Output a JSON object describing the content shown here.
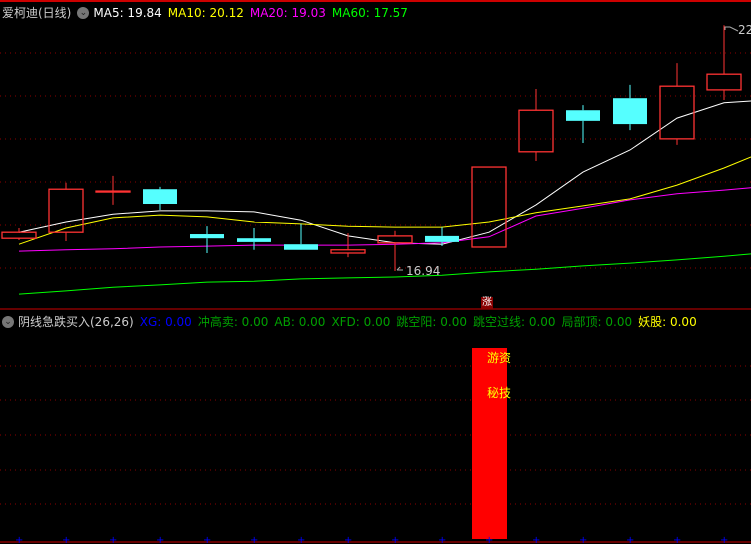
{
  "header": {
    "stock_name": "爱柯迪(日线)",
    "ma": [
      {
        "label": "MA5: 19.84",
        "color": "#ffffff"
      },
      {
        "label": "MA10: 20.12",
        "color": "#ffff00"
      },
      {
        "label": "MA20: 19.03",
        "color": "#ff00ff"
      },
      {
        "label": "MA60: 17.57",
        "color": "#00ff00"
      }
    ]
  },
  "indicator_header": {
    "name": "阴线急跌买入(26,26)",
    "items": [
      {
        "label": "XG: 0.00",
        "color": "#0000ff"
      },
      {
        "label": "冲高卖: 0.00",
        "color": "#00a000"
      },
      {
        "label": "AB: 0.00",
        "color": "#00a000"
      },
      {
        "label": "XFD: 0.00",
        "color": "#00a000"
      },
      {
        "label": "跳空阳: 0.00",
        "color": "#00a000"
      },
      {
        "label": "跳空过线: 0.00",
        "color": "#00a000"
      },
      {
        "label": "局部顶: 0.00",
        "color": "#00a000"
      },
      {
        "label": "妖股: 0.00",
        "color": "#ffff00"
      }
    ]
  },
  "annotations": {
    "high_label": "22",
    "low_label": "16.94",
    "up_marker": "涨",
    "signal_text_1": "游资",
    "signal_text_2": "秘技"
  },
  "colors": {
    "up": "#ff3333",
    "down": "#55ffff",
    "grid": "#8b0000",
    "border": "#cc0000"
  },
  "chart_data": [
    {
      "type": "candlestick",
      "candles": [
        {
          "o": 17.65,
          "h": 17.87,
          "l": 17.61,
          "c": 17.78
        },
        {
          "o": 17.78,
          "h": 18.85,
          "l": 17.59,
          "c": 18.71
        },
        {
          "o": 18.67,
          "h": 19.0,
          "l": 18.37,
          "c": 18.67
        },
        {
          "o": 18.71,
          "h": 18.76,
          "l": 18.26,
          "c": 18.39
        },
        {
          "o": 17.74,
          "h": 17.91,
          "l": 17.33,
          "c": 17.65
        },
        {
          "o": 17.65,
          "h": 17.87,
          "l": 17.4,
          "c": 17.57
        },
        {
          "o": 17.52,
          "h": 17.96,
          "l": 17.4,
          "c": 17.4
        },
        {
          "o": 17.33,
          "h": 17.76,
          "l": 17.24,
          "c": 17.4
        },
        {
          "o": 17.55,
          "h": 17.81,
          "l": 16.94,
          "c": 17.7
        },
        {
          "o": 17.7,
          "h": 17.89,
          "l": 17.48,
          "c": 17.57
        },
        {
          "o": 17.46,
          "h": 19.19,
          "l": 17.46,
          "c": 19.19
        },
        {
          "o": 19.52,
          "h": 20.88,
          "l": 19.32,
          "c": 20.42
        },
        {
          "o": 20.42,
          "h": 20.53,
          "l": 19.71,
          "c": 20.19
        },
        {
          "o": 20.68,
          "h": 20.97,
          "l": 19.99,
          "c": 20.12
        },
        {
          "o": 19.8,
          "h": 21.44,
          "l": 19.67,
          "c": 20.94
        },
        {
          "o": 20.86,
          "h": 22.26,
          "l": 20.64,
          "c": 21.2
        }
      ],
      "series": [
        {
          "name": "MA5",
          "color": "#ffffff",
          "values": [
            17.78,
            18.0,
            18.17,
            18.24,
            18.24,
            18.22,
            18.04,
            17.7,
            17.55,
            17.52,
            17.78,
            18.37,
            19.08,
            19.56,
            20.25,
            20.58,
            20.62
          ]
        },
        {
          "name": "MA10",
          "color": "#ffff00",
          "values": [
            17.52,
            17.87,
            18.09,
            18.15,
            18.11,
            18.0,
            17.96,
            17.91,
            17.89,
            17.89,
            18.0,
            18.2,
            18.35,
            18.5,
            18.8,
            19.17,
            19.41
          ]
        },
        {
          "name": "MA20",
          "color": "#ff00ff",
          "values": [
            17.37,
            17.4,
            17.42,
            17.46,
            17.48,
            17.5,
            17.5,
            17.5,
            17.52,
            17.55,
            17.68,
            18.13,
            18.3,
            18.48,
            18.61,
            18.69,
            18.74
          ]
        },
        {
          "name": "MA60",
          "color": "#00ff00",
          "values": [
            16.44,
            16.51,
            16.59,
            16.64,
            16.7,
            16.72,
            16.77,
            16.79,
            16.81,
            16.85,
            16.92,
            16.98,
            17.05,
            17.11,
            17.18,
            17.26,
            17.31
          ]
        }
      ],
      "ylim": [
        16.4,
        22.5
      ],
      "grid": true
    },
    {
      "type": "bar",
      "signal_index": 10,
      "values": [
        0,
        0,
        0,
        0,
        0,
        0,
        0,
        0,
        0,
        0,
        1,
        0,
        0,
        0,
        0,
        0
      ],
      "grid": true
    }
  ]
}
